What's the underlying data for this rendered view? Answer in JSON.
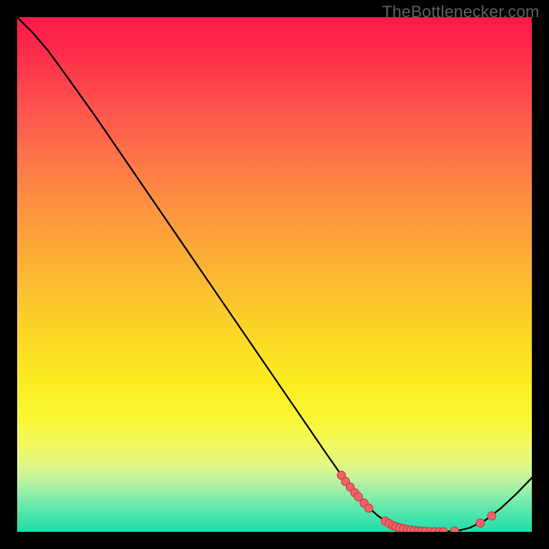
{
  "watermark": "TheBottlenecker.com",
  "colors": {
    "background": "#000000",
    "curve": "#000000",
    "marker_fill": "#ef6367",
    "marker_stroke": "#c23e41",
    "gradient_top": "#fe1748",
    "gradient_bottom": "#1fddaa"
  },
  "chart_data": {
    "type": "line",
    "title": "",
    "xlabel": "",
    "ylabel": "",
    "xlim": [
      0,
      100
    ],
    "ylim": [
      0,
      100
    ],
    "grid": false,
    "series": [
      {
        "name": "curve",
        "x": [
          0,
          3,
          6,
          10,
          15,
          20,
          25,
          30,
          35,
          40,
          45,
          50,
          55,
          60,
          63,
          65,
          68,
          70,
          72,
          74,
          76,
          78,
          80,
          82,
          84,
          86,
          88,
          91,
          94,
          97,
          100
        ],
        "y": [
          100,
          97,
          93.5,
          88,
          81,
          73.7,
          66.4,
          59.1,
          51.8,
          44.5,
          37.2,
          29.9,
          22.6,
          15.3,
          11,
          8.3,
          5,
          3.2,
          1.8,
          0.9,
          0.4,
          0.1,
          0,
          0,
          0.1,
          0.3,
          0.8,
          2.3,
          4.6,
          7.4,
          10.5
        ]
      }
    ],
    "markers": [
      {
        "name": "cluster-left",
        "x": [
          63.0,
          63.8,
          64.7,
          65.6,
          66.3,
          67.4,
          68.3
        ],
        "y": [
          11.0,
          9.8,
          8.7,
          7.6,
          6.8,
          5.6,
          4.6
        ]
      },
      {
        "name": "cluster-bottom",
        "x": [
          71.5,
          72.3,
          73.0,
          73.6,
          74.3,
          75.1,
          75.8,
          76.5,
          77.2,
          77.9,
          78.6,
          79.3,
          80.2,
          81.1,
          82.0,
          82.8,
          85.0
        ],
        "y": [
          2.1,
          1.6,
          1.2,
          1.0,
          0.8,
          0.6,
          0.45,
          0.35,
          0.25,
          0.18,
          0.12,
          0.08,
          0.04,
          0.02,
          0.0,
          0.0,
          0.15
        ]
      },
      {
        "name": "cluster-right",
        "x": [
          90.0,
          92.2
        ],
        "y": [
          1.7,
          3.1
        ]
      }
    ]
  }
}
